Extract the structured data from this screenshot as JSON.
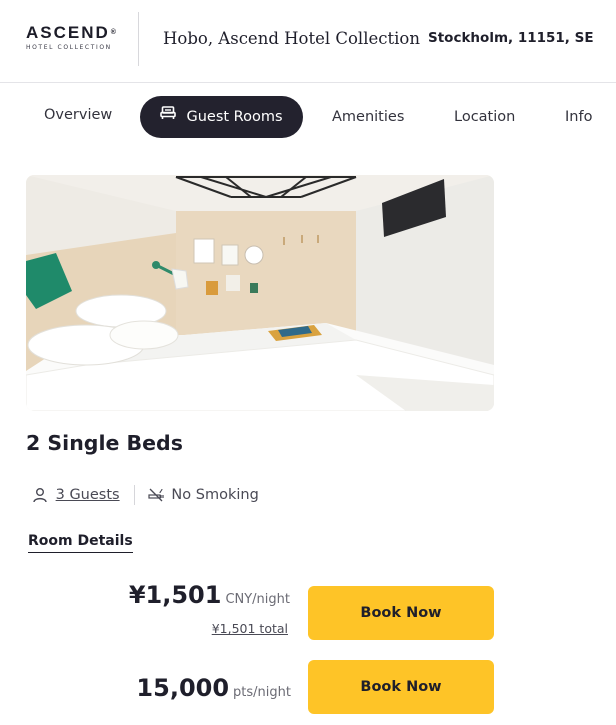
{
  "brand": {
    "logo_main": "ASCEND",
    "logo_tm": "®",
    "logo_sub": "HOTEL COLLECTION"
  },
  "header": {
    "hotel_name": "Hobo, Ascend Hotel Collection",
    "location": "Stockholm, 11151, SE"
  },
  "tabs": [
    {
      "label": "Overview",
      "active": false
    },
    {
      "label": "Guest Rooms",
      "active": true,
      "icon": "bed-icon"
    },
    {
      "label": "Amenities",
      "active": false
    },
    {
      "label": "Location",
      "active": false
    },
    {
      "label": "Info",
      "active": false
    }
  ],
  "room": {
    "photo": "hotel-room-photo",
    "title": "2 Single Beds",
    "guests": "3 Guests",
    "smoking": "No Smoking",
    "details_link": "Room Details"
  },
  "rates": [
    {
      "amount": "¥1,501",
      "unit": "CNY/night",
      "total": "¥1,501 total",
      "button": "Book Now"
    },
    {
      "amount": "15,000",
      "unit": "pts/night",
      "button": "Book Now"
    }
  ],
  "colors": {
    "accent": "#fec427",
    "active_tab": "#23222e",
    "text": "#1f1f2b"
  }
}
